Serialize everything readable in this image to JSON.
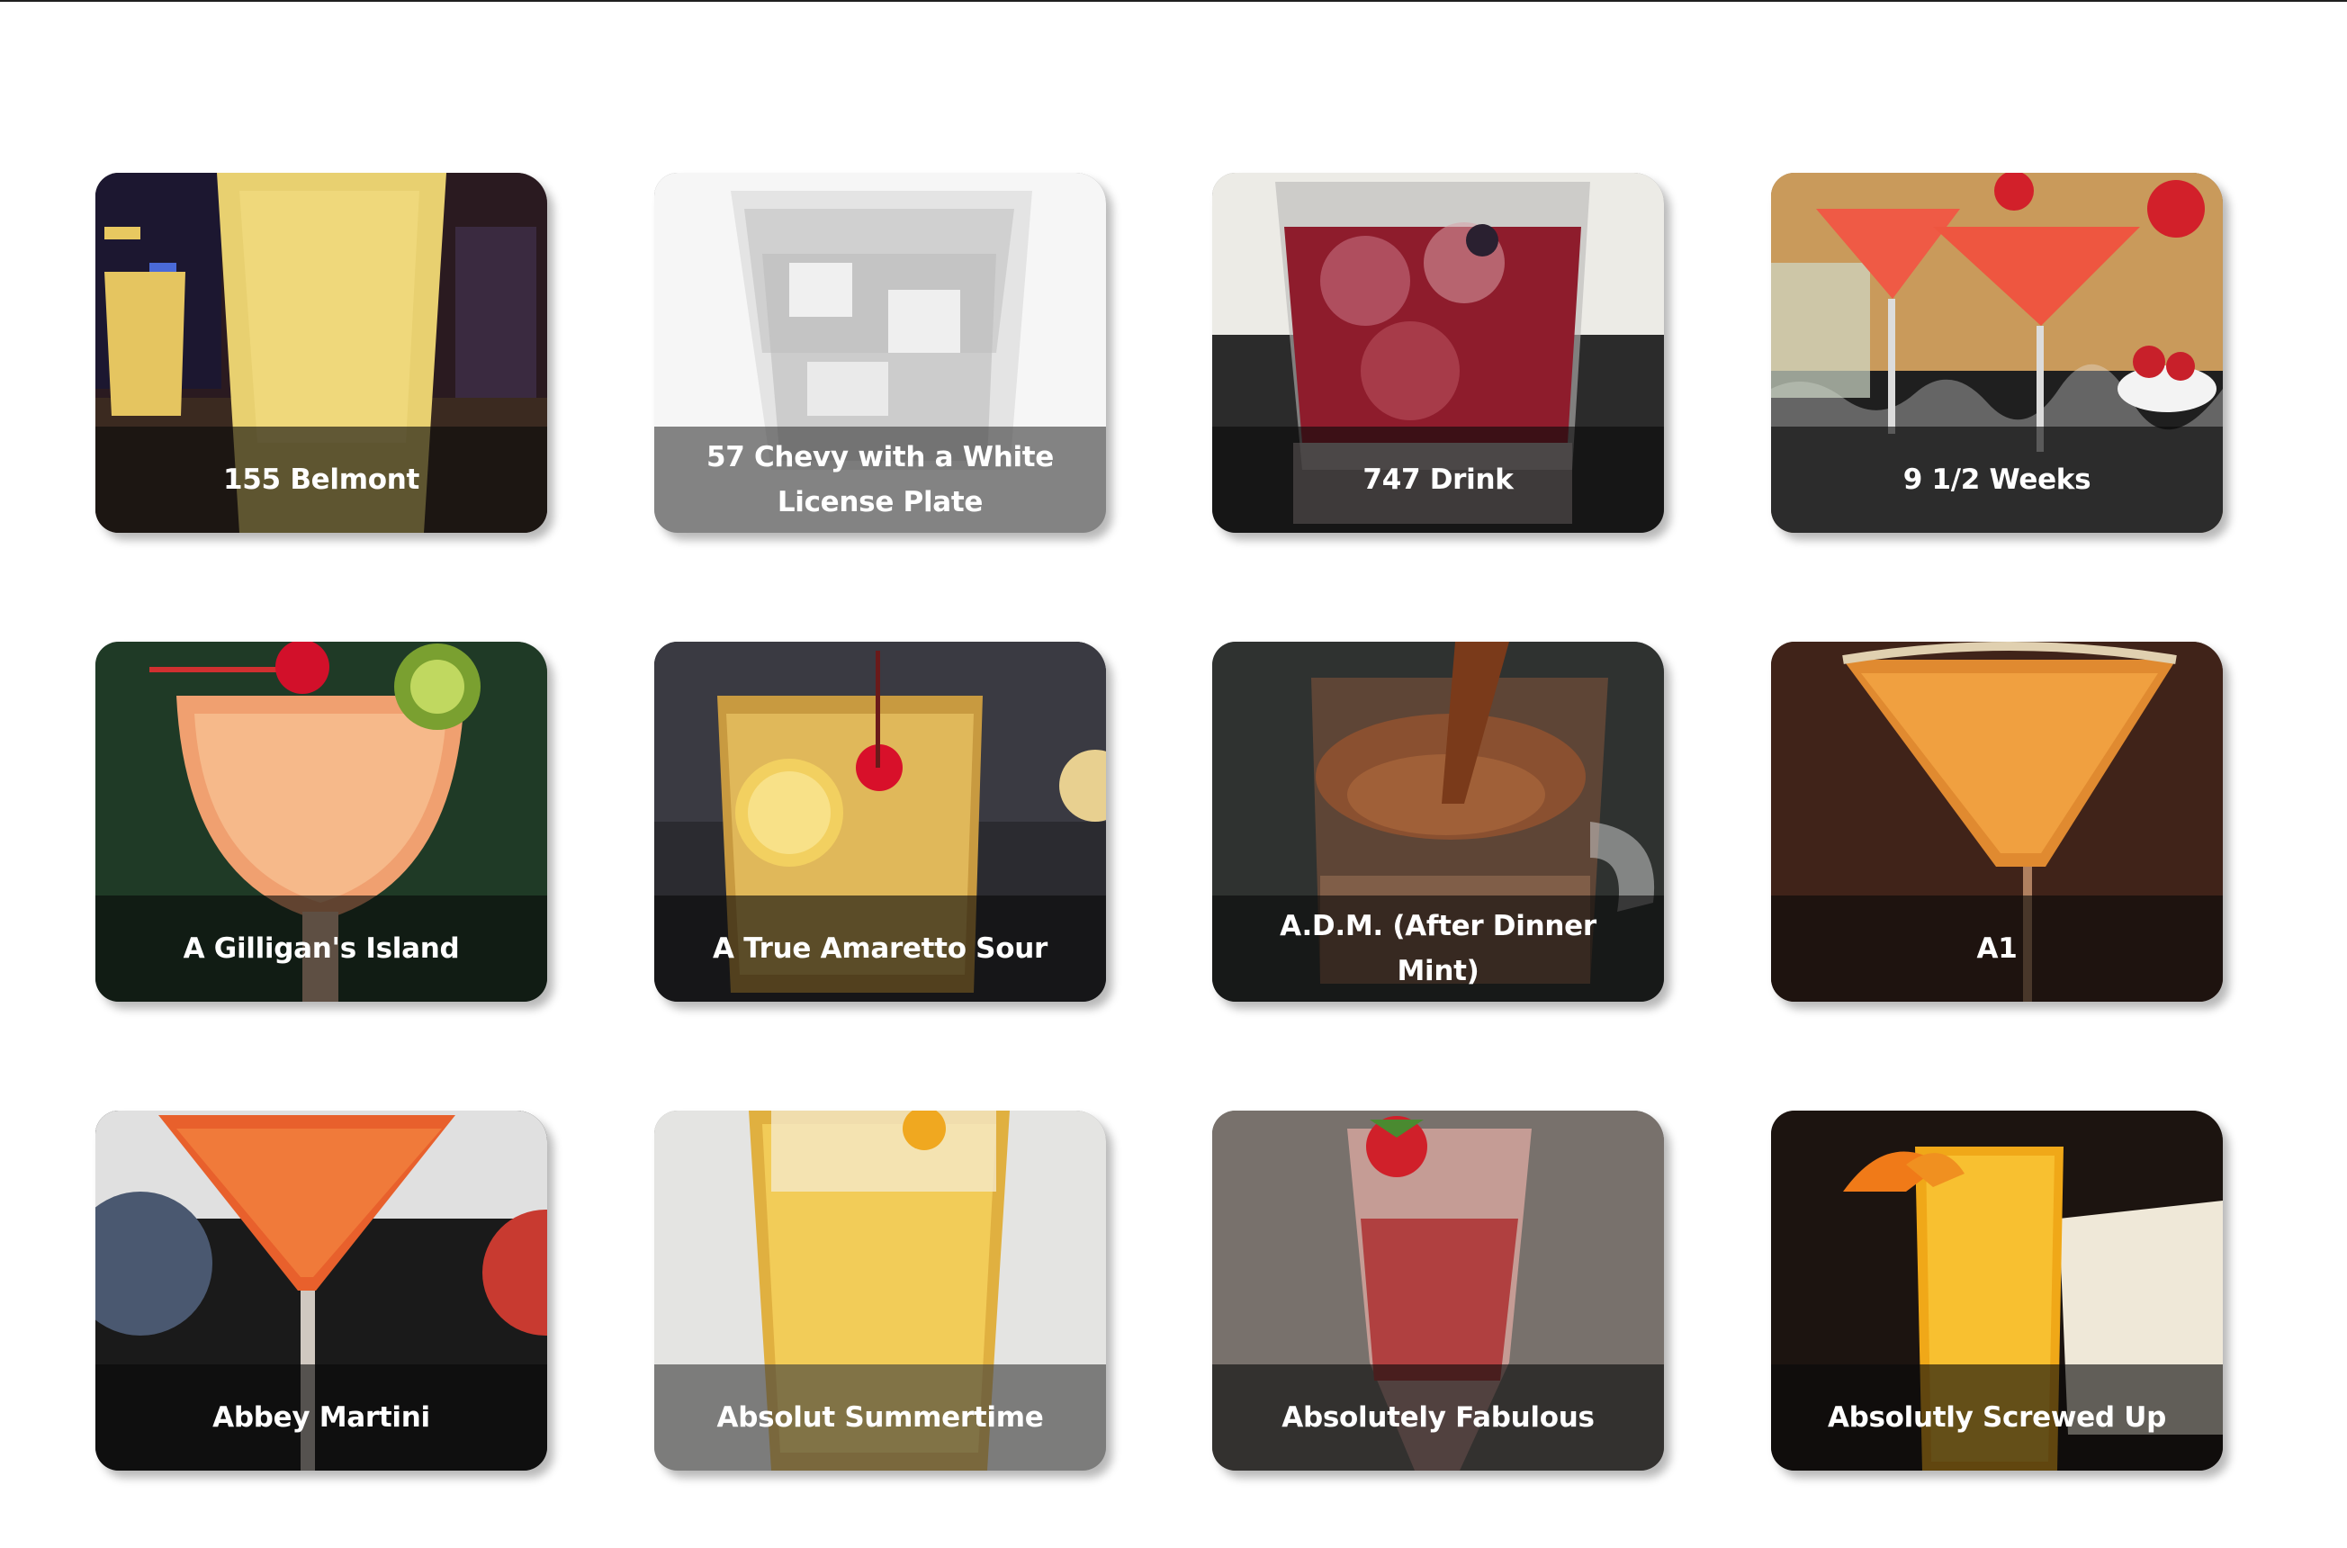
{
  "cards": [
    {
      "label": "155 Belmont",
      "image": "tall-yellow-cocktail-bar"
    },
    {
      "label": "57 Chevy with a White License Plate",
      "image": "clear-iced-glass-white"
    },
    {
      "label": "747 Drink",
      "image": "red-rocks-glass-cherry"
    },
    {
      "label": "9 1/2 Weeks",
      "image": "pink-martinis-strawberries"
    },
    {
      "label": "A Gilligan's Island",
      "image": "orange-tropical-kiwi-cherry"
    },
    {
      "label": "A True Amaretto Sour",
      "image": "amaretto-sour-lemon-cherry"
    },
    {
      "label": "A.D.M. (After Dinner Mint)",
      "image": "brown-drink-glass-mug"
    },
    {
      "label": "A1",
      "image": "orange-martini-sugar-rim"
    },
    {
      "label": "Abbey Martini",
      "image": "orange-martini-dark"
    },
    {
      "label": "Absolut Summertime",
      "image": "yellow-fizzy-highball"
    },
    {
      "label": "Absolutely Fabulous",
      "image": "pink-champagne-strawberry"
    },
    {
      "label": "Absolutly Screwed Up",
      "image": "orange-juice-highball-book"
    }
  ]
}
